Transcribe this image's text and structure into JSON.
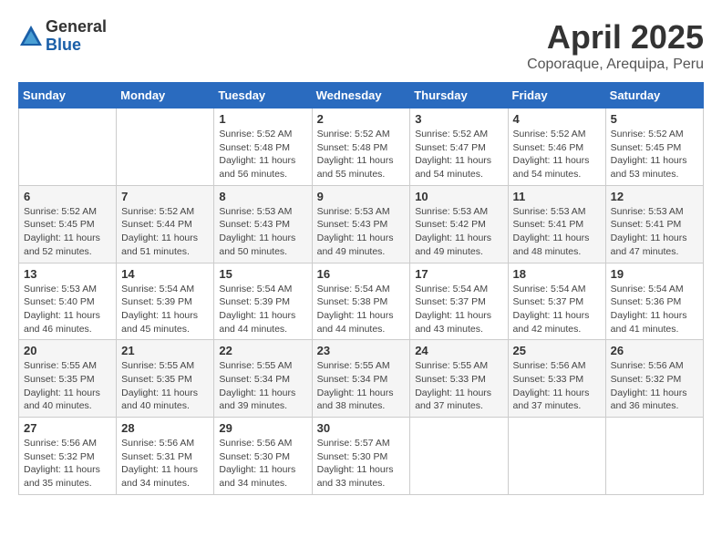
{
  "header": {
    "logo_general": "General",
    "logo_blue": "Blue",
    "month_title": "April 2025",
    "location": "Coporaque, Arequipa, Peru"
  },
  "days_of_week": [
    "Sunday",
    "Monday",
    "Tuesday",
    "Wednesday",
    "Thursday",
    "Friday",
    "Saturday"
  ],
  "weeks": [
    [
      {
        "day": "",
        "detail": ""
      },
      {
        "day": "",
        "detail": ""
      },
      {
        "day": "1",
        "detail": "Sunrise: 5:52 AM\nSunset: 5:48 PM\nDaylight: 11 hours and 56 minutes."
      },
      {
        "day": "2",
        "detail": "Sunrise: 5:52 AM\nSunset: 5:48 PM\nDaylight: 11 hours and 55 minutes."
      },
      {
        "day": "3",
        "detail": "Sunrise: 5:52 AM\nSunset: 5:47 PM\nDaylight: 11 hours and 54 minutes."
      },
      {
        "day": "4",
        "detail": "Sunrise: 5:52 AM\nSunset: 5:46 PM\nDaylight: 11 hours and 54 minutes."
      },
      {
        "day": "5",
        "detail": "Sunrise: 5:52 AM\nSunset: 5:45 PM\nDaylight: 11 hours and 53 minutes."
      }
    ],
    [
      {
        "day": "6",
        "detail": "Sunrise: 5:52 AM\nSunset: 5:45 PM\nDaylight: 11 hours and 52 minutes."
      },
      {
        "day": "7",
        "detail": "Sunrise: 5:52 AM\nSunset: 5:44 PM\nDaylight: 11 hours and 51 minutes."
      },
      {
        "day": "8",
        "detail": "Sunrise: 5:53 AM\nSunset: 5:43 PM\nDaylight: 11 hours and 50 minutes."
      },
      {
        "day": "9",
        "detail": "Sunrise: 5:53 AM\nSunset: 5:43 PM\nDaylight: 11 hours and 49 minutes."
      },
      {
        "day": "10",
        "detail": "Sunrise: 5:53 AM\nSunset: 5:42 PM\nDaylight: 11 hours and 49 minutes."
      },
      {
        "day": "11",
        "detail": "Sunrise: 5:53 AM\nSunset: 5:41 PM\nDaylight: 11 hours and 48 minutes."
      },
      {
        "day": "12",
        "detail": "Sunrise: 5:53 AM\nSunset: 5:41 PM\nDaylight: 11 hours and 47 minutes."
      }
    ],
    [
      {
        "day": "13",
        "detail": "Sunrise: 5:53 AM\nSunset: 5:40 PM\nDaylight: 11 hours and 46 minutes."
      },
      {
        "day": "14",
        "detail": "Sunrise: 5:54 AM\nSunset: 5:39 PM\nDaylight: 11 hours and 45 minutes."
      },
      {
        "day": "15",
        "detail": "Sunrise: 5:54 AM\nSunset: 5:39 PM\nDaylight: 11 hours and 44 minutes."
      },
      {
        "day": "16",
        "detail": "Sunrise: 5:54 AM\nSunset: 5:38 PM\nDaylight: 11 hours and 44 minutes."
      },
      {
        "day": "17",
        "detail": "Sunrise: 5:54 AM\nSunset: 5:37 PM\nDaylight: 11 hours and 43 minutes."
      },
      {
        "day": "18",
        "detail": "Sunrise: 5:54 AM\nSunset: 5:37 PM\nDaylight: 11 hours and 42 minutes."
      },
      {
        "day": "19",
        "detail": "Sunrise: 5:54 AM\nSunset: 5:36 PM\nDaylight: 11 hours and 41 minutes."
      }
    ],
    [
      {
        "day": "20",
        "detail": "Sunrise: 5:55 AM\nSunset: 5:35 PM\nDaylight: 11 hours and 40 minutes."
      },
      {
        "day": "21",
        "detail": "Sunrise: 5:55 AM\nSunset: 5:35 PM\nDaylight: 11 hours and 40 minutes."
      },
      {
        "day": "22",
        "detail": "Sunrise: 5:55 AM\nSunset: 5:34 PM\nDaylight: 11 hours and 39 minutes."
      },
      {
        "day": "23",
        "detail": "Sunrise: 5:55 AM\nSunset: 5:34 PM\nDaylight: 11 hours and 38 minutes."
      },
      {
        "day": "24",
        "detail": "Sunrise: 5:55 AM\nSunset: 5:33 PM\nDaylight: 11 hours and 37 minutes."
      },
      {
        "day": "25",
        "detail": "Sunrise: 5:56 AM\nSunset: 5:33 PM\nDaylight: 11 hours and 37 minutes."
      },
      {
        "day": "26",
        "detail": "Sunrise: 5:56 AM\nSunset: 5:32 PM\nDaylight: 11 hours and 36 minutes."
      }
    ],
    [
      {
        "day": "27",
        "detail": "Sunrise: 5:56 AM\nSunset: 5:32 PM\nDaylight: 11 hours and 35 minutes."
      },
      {
        "day": "28",
        "detail": "Sunrise: 5:56 AM\nSunset: 5:31 PM\nDaylight: 11 hours and 34 minutes."
      },
      {
        "day": "29",
        "detail": "Sunrise: 5:56 AM\nSunset: 5:30 PM\nDaylight: 11 hours and 34 minutes."
      },
      {
        "day": "30",
        "detail": "Sunrise: 5:57 AM\nSunset: 5:30 PM\nDaylight: 11 hours and 33 minutes."
      },
      {
        "day": "",
        "detail": ""
      },
      {
        "day": "",
        "detail": ""
      },
      {
        "day": "",
        "detail": ""
      }
    ]
  ]
}
